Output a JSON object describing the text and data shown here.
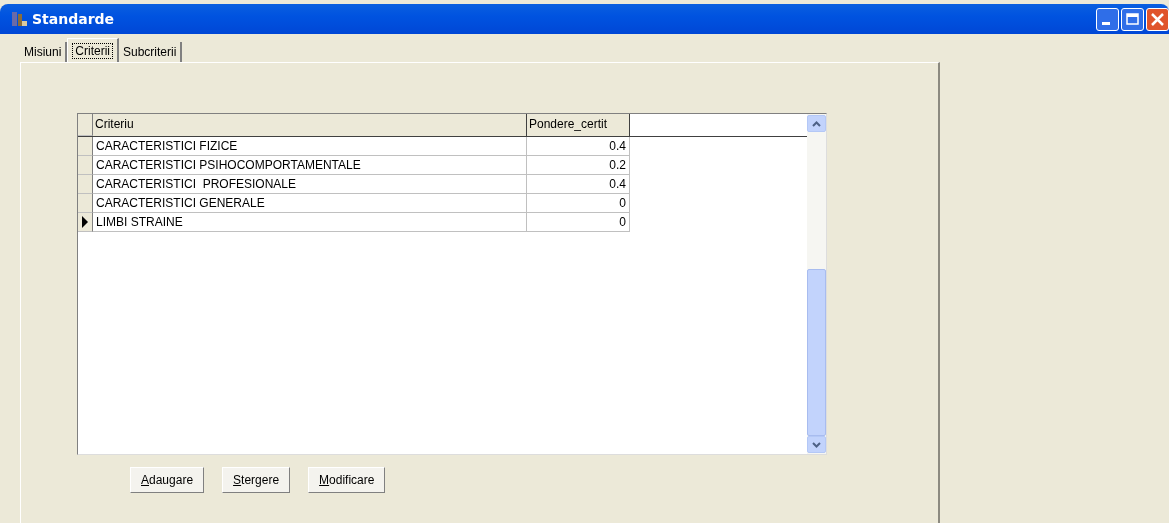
{
  "window": {
    "title": "Standarde"
  },
  "tabs": [
    {
      "label": "Misiuni",
      "selected": false
    },
    {
      "label": "Criterii",
      "selected": true
    },
    {
      "label": "Subcriterii",
      "selected": false
    }
  ],
  "table": {
    "columns": [
      "Criteriu",
      "Pondere_certit"
    ],
    "rows": [
      {
        "cells": [
          "CARACTERISTICI FIZICE",
          "0.4"
        ],
        "selected": false
      },
      {
        "cells": [
          "CARACTERISTICI PSIHOCOMPORTAMENTALE",
          "0.2"
        ],
        "selected": false
      },
      {
        "cells": [
          "CARACTERISTICI  PROFESIONALE",
          "0.4"
        ],
        "selected": false
      },
      {
        "cells": [
          "CARACTERISTICI GENERALE",
          "0"
        ],
        "selected": false
      },
      {
        "cells": [
          "LIMBI STRAINE",
          "0"
        ],
        "selected": true
      }
    ]
  },
  "buttons": [
    {
      "label": "Adaugare"
    },
    {
      "label": "Stergere"
    },
    {
      "label": "Modificare"
    }
  ]
}
